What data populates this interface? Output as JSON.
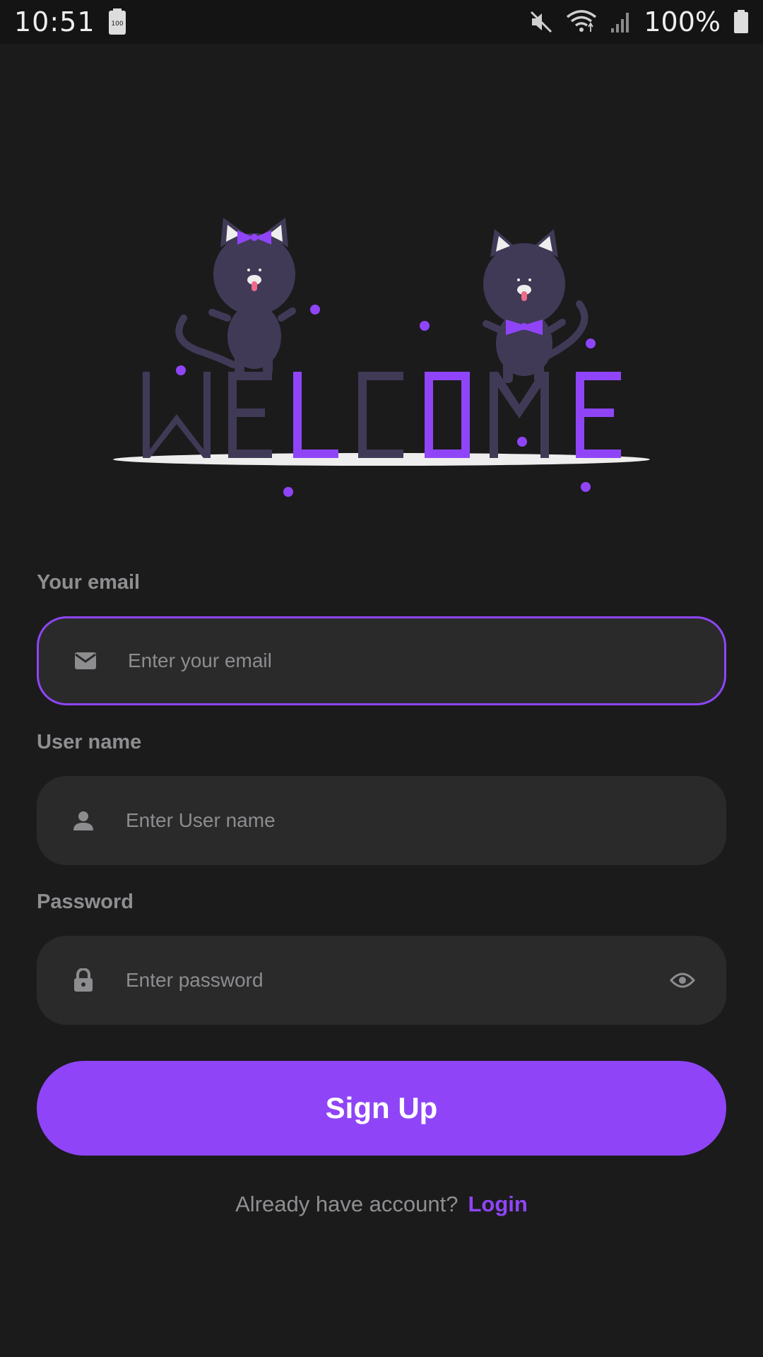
{
  "status_bar": {
    "time": "10:51",
    "battery_badge": "100",
    "battery_percent": "100%"
  },
  "hero": {
    "word": "WELCOME",
    "accent_color": "#8f45f7",
    "dark_color": "#403a57"
  },
  "form": {
    "email": {
      "label": "Your email",
      "placeholder": "Enter your email",
      "value": ""
    },
    "username": {
      "label": "User name",
      "placeholder": "Enter User name",
      "value": ""
    },
    "password": {
      "label": "Password",
      "placeholder": "Enter password",
      "value": ""
    }
  },
  "actions": {
    "signup_label": "Sign Up",
    "login_prompt": "Already have account?",
    "login_link": "Login"
  },
  "colors": {
    "background": "#1b1b1c",
    "field": "#2a2a2b",
    "accent": "#8f45f7",
    "muted_text": "#8f8f92"
  }
}
